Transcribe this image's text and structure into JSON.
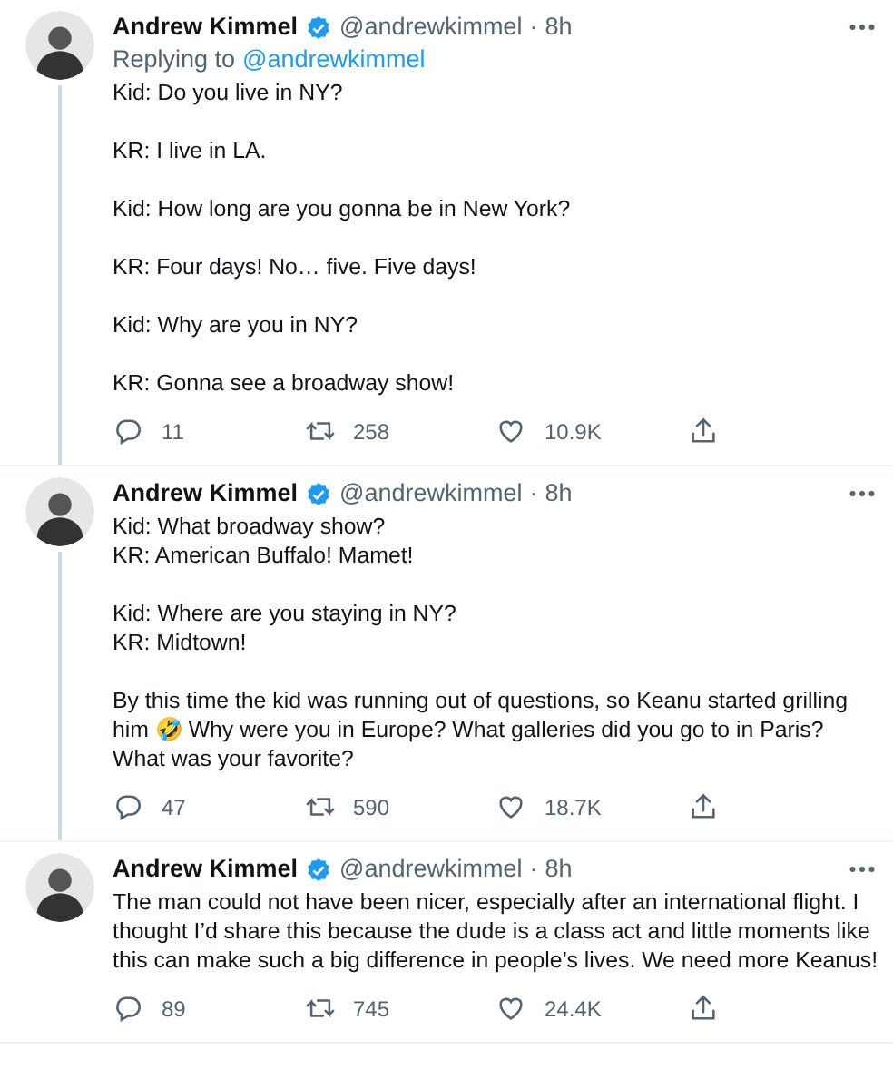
{
  "tweets": [
    {
      "name": "Andrew Kimmel",
      "verified": true,
      "handle": "@andrewkimmel",
      "separator": "·",
      "time": "8h",
      "reply_prefix": "Replying to",
      "reply_to": "@andrewkimmel",
      "text": "Kid: Do you live in NY?\n\nKR: I live in LA.\n\nKid: How long are you gonna be in New York?\n\nKR: Four days! No… five. Five days!\n\nKid: Why are you in NY?\n\nKR: Gonna see a broadway show!",
      "replies": "11",
      "retweets": "258",
      "likes": "10.9K"
    },
    {
      "name": "Andrew Kimmel",
      "verified": true,
      "handle": "@andrewkimmel",
      "separator": "·",
      "time": "8h",
      "text": "Kid: What broadway show?\nKR: American Buffalo! Mamet!\n\nKid: Where are you staying in NY?\nKR: Midtown!\n\nBy this time the kid was running out of questions, so Keanu started grilling him 🤣 Why were you in Europe? What galleries did you go to in Paris? What was your favorite?",
      "replies": "47",
      "retweets": "590",
      "likes": "18.7K"
    },
    {
      "name": "Andrew Kimmel",
      "verified": true,
      "handle": "@andrewkimmel",
      "separator": "·",
      "time": "8h",
      "text": "The man could not have been nicer, especially after an international flight. I thought I’d share this because the dude is a class act and little moments like this can make such a big difference in people’s lives. We need more Keanus!",
      "replies": "89",
      "retweets": "745",
      "likes": "24.4K"
    }
  ]
}
